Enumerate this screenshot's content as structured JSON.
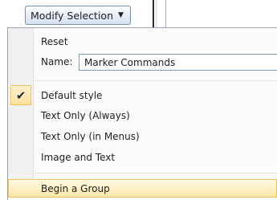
{
  "toolbar": {
    "modify_selection_label": "Modify Selection",
    "chevron_glyph": "▼"
  },
  "menu": {
    "reset_label": "Reset",
    "name_label": "Name:",
    "name_value": "Marker Commands",
    "check_glyph": "✔",
    "styles": [
      {
        "label": "Default style",
        "checked": true
      },
      {
        "label": "Text Only (Always)",
        "checked": false
      },
      {
        "label": "Text Only (in Menus)",
        "checked": false
      },
      {
        "label": "Image and Text",
        "checked": false
      }
    ],
    "begin_group_label": "Begin a Group"
  },
  "colors": {
    "highlight_border": "#f2c35a",
    "highlight_fill": "#ffe7a8",
    "gutter": "#f1f1f1",
    "input_border": "#7f9db9"
  }
}
